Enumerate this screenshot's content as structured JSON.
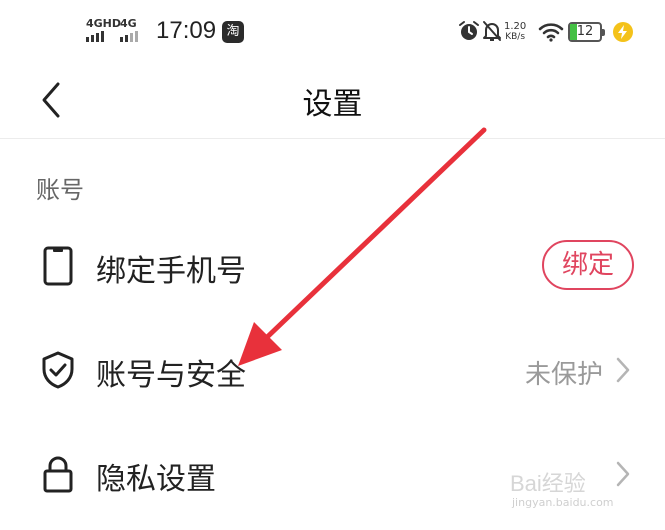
{
  "status_bar": {
    "sim1_label": "4GHD",
    "sim2_label": "4G",
    "time": "17:09",
    "app_badge": "淘",
    "net_speed_value": "1.20",
    "net_speed_unit": "KB/s",
    "battery_level": "12",
    "icons": [
      "alarm-icon",
      "mute-bell-icon",
      "wifi-icon",
      "battery-icon",
      "charging-icon"
    ]
  },
  "header": {
    "title": "设置"
  },
  "sections": [
    {
      "label": "账号",
      "items": [
        {
          "icon": "phone-icon",
          "label": "绑定手机号",
          "action": "绑定"
        },
        {
          "icon": "shield-check-icon",
          "label": "账号与安全",
          "status": "未保护"
        },
        {
          "icon": "lock-icon",
          "label": "隐私设置"
        }
      ]
    }
  ],
  "watermark": {
    "text": "Bai经验",
    "sub": "jingyan.baidu.com"
  },
  "colors": {
    "accent": "#e0455f",
    "annotation_arrow": "#e8313b",
    "secondary_text": "#9a9a9a"
  }
}
